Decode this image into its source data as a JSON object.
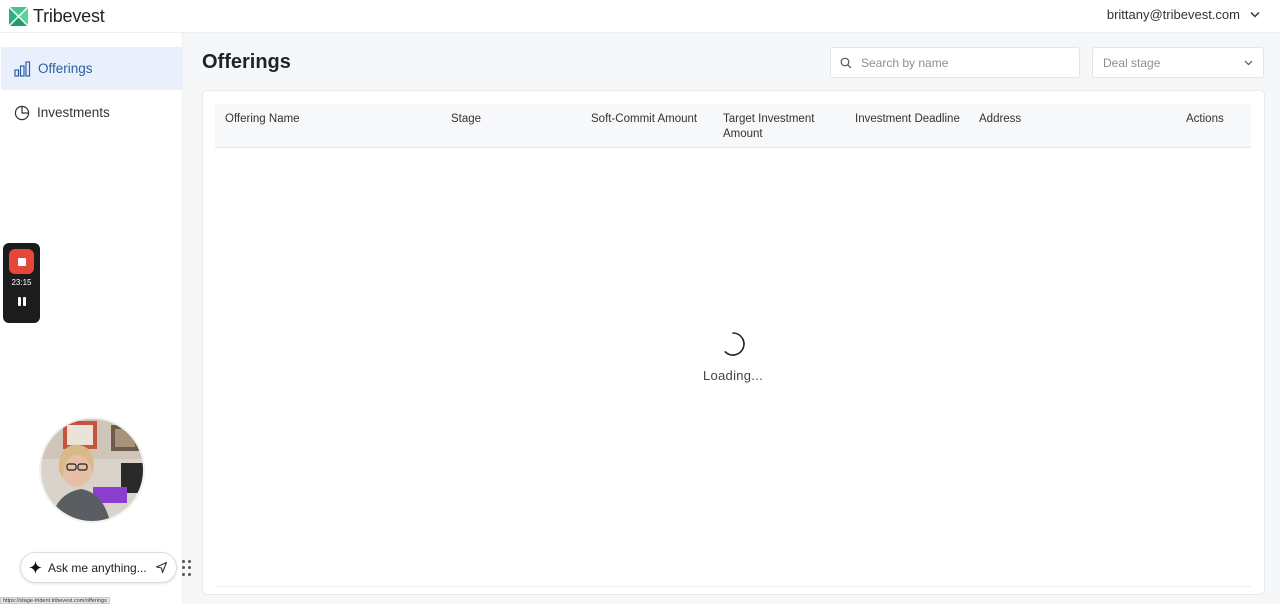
{
  "app": {
    "brand_name": "Tribevest",
    "user_email": "brittany@tribevest.com"
  },
  "sidebar": {
    "items": [
      {
        "label": "Offerings",
        "icon": "bar-chart-icon",
        "active": true
      },
      {
        "label": "Investments",
        "icon": "pie-chart-icon",
        "active": false
      }
    ]
  },
  "main": {
    "title": "Offerings",
    "search_placeholder": "Search by name",
    "deal_stage_placeholder": "Deal stage",
    "table": {
      "columns": [
        "Offering Name",
        "Stage",
        "Soft-Commit Amount",
        "Target Investment\nAmount",
        "Investment Deadline",
        "Address",
        "Actions"
      ],
      "rows": []
    },
    "loading_text": "Loading..."
  },
  "recorder": {
    "elapsed": "23:15"
  },
  "assistant": {
    "placeholder": "Ask me anything..."
  },
  "status_bar": {
    "url": "https://stage-trident.tribevest.com/offerings"
  },
  "colors": {
    "accent": "#2b5ea8",
    "active_nav_bg": "#e9f0fb",
    "brand_green": "#3fbf8f",
    "record_red": "#e5483b"
  }
}
